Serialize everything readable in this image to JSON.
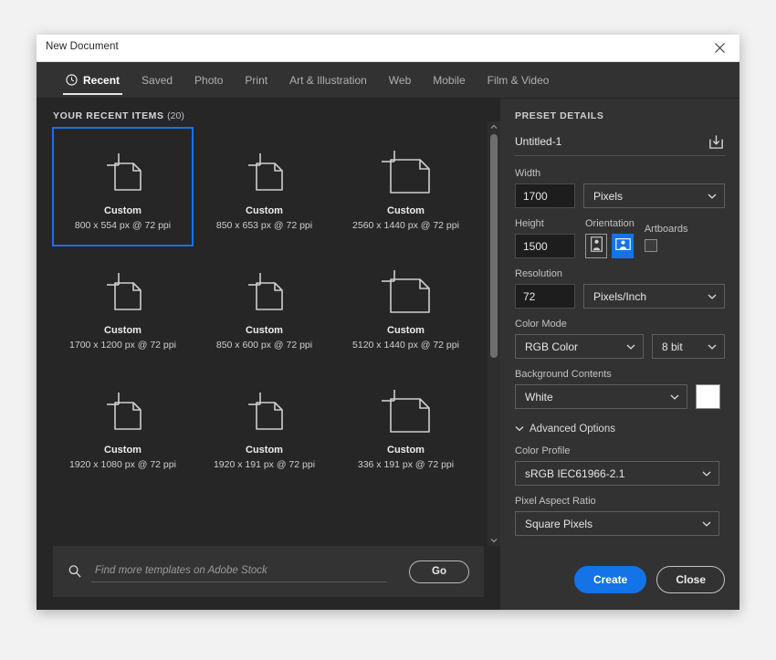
{
  "window": {
    "title": "New Document",
    "close_icon": "close-icon"
  },
  "tabs": [
    {
      "label": "Recent",
      "icon": "clock-icon",
      "active": true
    },
    {
      "label": "Saved",
      "icon": "",
      "active": false
    },
    {
      "label": "Photo",
      "icon": "",
      "active": false
    },
    {
      "label": "Print",
      "icon": "",
      "active": false
    },
    {
      "label": "Art & Illustration",
      "icon": "",
      "active": false
    },
    {
      "label": "Web",
      "icon": "",
      "active": false
    },
    {
      "label": "Mobile",
      "icon": "",
      "active": false
    },
    {
      "label": "Film & Video",
      "icon": "",
      "active": false
    }
  ],
  "recent": {
    "header": "YOUR RECENT ITEMS",
    "count": "(20)",
    "items": [
      {
        "name": "Custom",
        "dims": "800 x 554 px @ 72 ppi",
        "selected": true,
        "size": "small"
      },
      {
        "name": "Custom",
        "dims": "850 x 653 px @ 72 ppi",
        "selected": false,
        "size": "small"
      },
      {
        "name": "Custom",
        "dims": "2560 x 1440 px @ 72 ppi",
        "selected": false,
        "size": "large"
      },
      {
        "name": "Custom",
        "dims": "1700 x 1200 px @ 72 ppi",
        "selected": false,
        "size": "small"
      },
      {
        "name": "Custom",
        "dims": "850 x 600 px @ 72 ppi",
        "selected": false,
        "size": "small"
      },
      {
        "name": "Custom",
        "dims": "5120 x 1440 px @ 72 ppi",
        "selected": false,
        "size": "large"
      },
      {
        "name": "Custom",
        "dims": "1920 x 1080 px @ 72 ppi",
        "selected": false,
        "size": "small"
      },
      {
        "name": "Custom",
        "dims": "1920 x 191 px @ 72 ppi",
        "selected": false,
        "size": "small"
      },
      {
        "name": "Custom",
        "dims": "336 x 191 px @ 72 ppi",
        "selected": false,
        "size": "large"
      }
    ]
  },
  "stock": {
    "placeholder": "Find more templates on Adobe Stock",
    "value": "",
    "search_icon": "search-icon",
    "go_label": "Go"
  },
  "preset": {
    "header": "PRESET DETAILS",
    "doc_name": "Untitled-1",
    "save_preset_icon": "save-preset-icon",
    "width": {
      "label": "Width",
      "value": "1700",
      "unit": "Pixels"
    },
    "height": {
      "label": "Height",
      "value": "1500"
    },
    "orientation": {
      "label": "Orientation",
      "portrait": "portrait-icon",
      "landscape": "landscape-icon",
      "selected": "landscape"
    },
    "artboards": {
      "label": "Artboards",
      "checked": false
    },
    "resolution": {
      "label": "Resolution",
      "value": "72",
      "unit": "Pixels/Inch"
    },
    "color_mode": {
      "label": "Color Mode",
      "value": "RGB Color",
      "depth": "8 bit"
    },
    "background": {
      "label": "Background Contents",
      "value": "White",
      "swatch": "#ffffff"
    },
    "advanced": {
      "label": "Advanced Options",
      "expanded": true
    },
    "color_profile": {
      "label": "Color Profile",
      "value": "sRGB IEC61966-2.1"
    },
    "pixel_aspect": {
      "label": "Pixel Aspect Ratio",
      "value": "Square Pixels"
    }
  },
  "footer": {
    "create_label": "Create",
    "close_label": "Close"
  },
  "colors": {
    "accent": "#1473e6",
    "panel_bg": "#323232",
    "content_bg": "#262626"
  }
}
